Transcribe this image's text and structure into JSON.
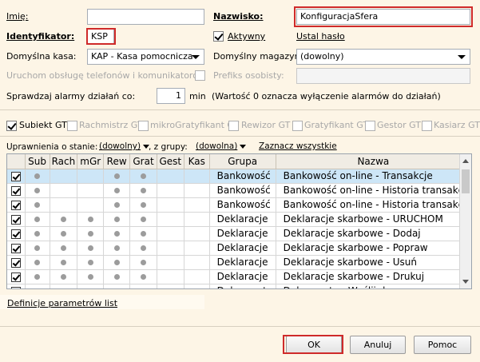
{
  "form": {
    "imie_label": "Imię:",
    "imie_value": "",
    "nazwisko_label": "Nazwisko:",
    "nazwisko_value": "KonfiguracjaSfera",
    "identyfikator_label": "Identyfikator:",
    "identyfikator_value": "KSP",
    "aktywny_label": "Aktywny",
    "ustal_haslo_label": "Ustal hasło",
    "kasa_label": "Domyślna kasa:",
    "kasa_value": "KAP - Kasa pomocnicza",
    "magazyn_label": "Domyślny magazyn:",
    "magazyn_value": "(dowolny)",
    "telefony_label": "Uruchom obsługę telefonów i komunikatorów",
    "prefiks_label": "Prefiks osobisty:",
    "prefiks_value": "",
    "alarmy_label": "Sprawdzaj alarmy działań co:",
    "alarmy_value": "1",
    "alarmy_unit": "min",
    "alarmy_note": "(Wartość 0 oznacza wyłączenie alarmów do działań)"
  },
  "modules": [
    {
      "label": "Subiekt GT",
      "checked": true,
      "enabled": true
    },
    {
      "label": "Rachmistrz GT",
      "checked": false,
      "enabled": false
    },
    {
      "label": "mikroGratyfikant GT",
      "checked": false,
      "enabled": false
    },
    {
      "label": "Rewizor GT",
      "checked": false,
      "enabled": false
    },
    {
      "label": "Gratyfikant GT",
      "checked": false,
      "enabled": false
    },
    {
      "label": "Gestor GT",
      "checked": false,
      "enabled": false
    },
    {
      "label": "Kasiarz GT",
      "checked": false,
      "enabled": false
    }
  ],
  "filter": {
    "stan_label": "Uprawnienia o stanie:",
    "stan_value": "(dowolny)",
    "grupa_label": ", z grupy:",
    "grupa_value": "(dowolna)",
    "zaznacz_label": "Zaznacz wszystkie"
  },
  "grid": {
    "headers": [
      "",
      "Sub",
      "Rach",
      "mGr",
      "Rew",
      "Grat",
      "Gest",
      "Kas",
      "Grupa",
      "Nazwa"
    ],
    "rows": [
      {
        "checked": true,
        "dots": [
          1,
          0,
          0,
          1,
          1,
          0,
          0
        ],
        "grupa": "Bankowość",
        "nazwa": "Bankowość on-line - Transakcje",
        "selected": true
      },
      {
        "checked": true,
        "dots": [
          1,
          0,
          0,
          1,
          1,
          0,
          0
        ],
        "grupa": "Bankowość",
        "nazwa": "Bankowość on-line - Historia transakcji"
      },
      {
        "checked": true,
        "dots": [
          1,
          0,
          0,
          1,
          1,
          0,
          0
        ],
        "grupa": "Bankowość",
        "nazwa": "Bankowość on-line - Historia transakcji"
      },
      {
        "checked": true,
        "dots": [
          1,
          1,
          1,
          1,
          1,
          0,
          0
        ],
        "grupa": "Deklaracje",
        "nazwa": "Deklaracje skarbowe - URUCHOM"
      },
      {
        "checked": true,
        "dots": [
          1,
          1,
          1,
          1,
          1,
          0,
          0
        ],
        "grupa": "Deklaracje",
        "nazwa": "Deklaracje skarbowe - Dodaj"
      },
      {
        "checked": true,
        "dots": [
          1,
          1,
          1,
          1,
          1,
          0,
          0
        ],
        "grupa": "Deklaracje",
        "nazwa": "Deklaracje skarbowe - Popraw"
      },
      {
        "checked": true,
        "dots": [
          1,
          1,
          1,
          1,
          1,
          0,
          0
        ],
        "grupa": "Deklaracje",
        "nazwa": "Deklaracje skarbowe - Usuń"
      },
      {
        "checked": true,
        "dots": [
          1,
          1,
          1,
          1,
          1,
          0,
          0
        ],
        "grupa": "Deklaracje",
        "nazwa": "Deklaracje skarbowe - Drukuj"
      },
      {
        "checked": true,
        "dots": [
          1,
          1,
          1,
          1,
          1,
          0,
          0
        ],
        "grupa": "Dokumenty",
        "nazwa": "Dokumenty - Wyślij do"
      }
    ]
  },
  "footer": {
    "definicje_label": "Definicje parametrów list",
    "ok_label": "OK",
    "anuluj_label": "Anuluj",
    "pomoc_label": "Pomoc"
  }
}
